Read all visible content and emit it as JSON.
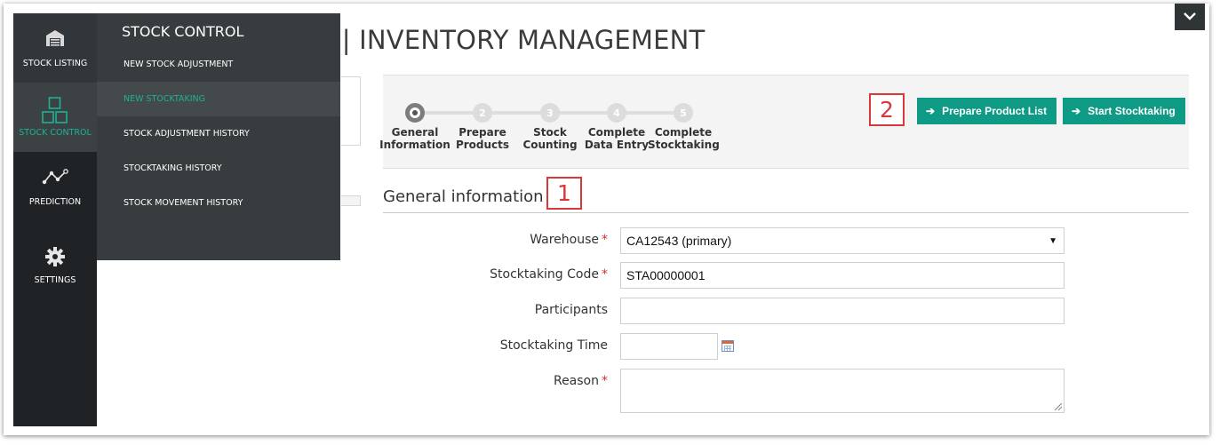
{
  "page": {
    "title_fragment": "L | INVENTORY MANAGEMENT"
  },
  "sidebar": {
    "items": [
      {
        "label": "STOCK LISTING",
        "icon": "warehouse-icon"
      },
      {
        "label": "STOCK CONTROL",
        "icon": "boxes-icon",
        "active": true
      },
      {
        "label": "PREDICTION",
        "icon": "trend-line-icon"
      },
      {
        "label": "SETTINGS",
        "icon": "gear-icon"
      }
    ]
  },
  "submenu": {
    "heading": "STOCK CONTROL",
    "items": [
      {
        "label": "NEW STOCK ADJUSTMENT"
      },
      {
        "label": "NEW STOCKTAKING",
        "active": true
      },
      {
        "label": "STOCK ADJUSTMENT HISTORY"
      },
      {
        "label": "STOCKTAKING HISTORY"
      },
      {
        "label": "STOCK MOVEMENT HISTORY"
      }
    ]
  },
  "steps": [
    {
      "number": "1",
      "line1": "General",
      "line2": "Information",
      "active": true
    },
    {
      "number": "2",
      "line1": "Prepare",
      "line2": "Products"
    },
    {
      "number": "3",
      "line1": "Stock",
      "line2": "Counting"
    },
    {
      "number": "4",
      "line1": "Complete",
      "line2": "Data Entry"
    },
    {
      "number": "5",
      "line1": "Complete",
      "line2": "Stocktaking"
    }
  ],
  "actions": {
    "prepare_label": "Prepare Product List",
    "start_label": "Start Stocktaking"
  },
  "callouts": {
    "one": "1",
    "two": "2"
  },
  "section": {
    "title": "General information"
  },
  "form": {
    "warehouse": {
      "label": "Warehouse",
      "required": "*",
      "value": "CA12543 (primary)"
    },
    "code": {
      "label": "Stocktaking Code",
      "required": "*",
      "value": "STA00000001"
    },
    "participants": {
      "label": "Participants",
      "value": ""
    },
    "time": {
      "label": "Stocktaking Time",
      "value": ""
    },
    "reason": {
      "label": "Reason",
      "required": "*",
      "value": ""
    }
  },
  "colors": {
    "accent": "#0e9a85",
    "sidebar": "#1f2326",
    "submenu": "#373c3f",
    "callout": "#d9383a",
    "active_text": "#1bb394"
  }
}
